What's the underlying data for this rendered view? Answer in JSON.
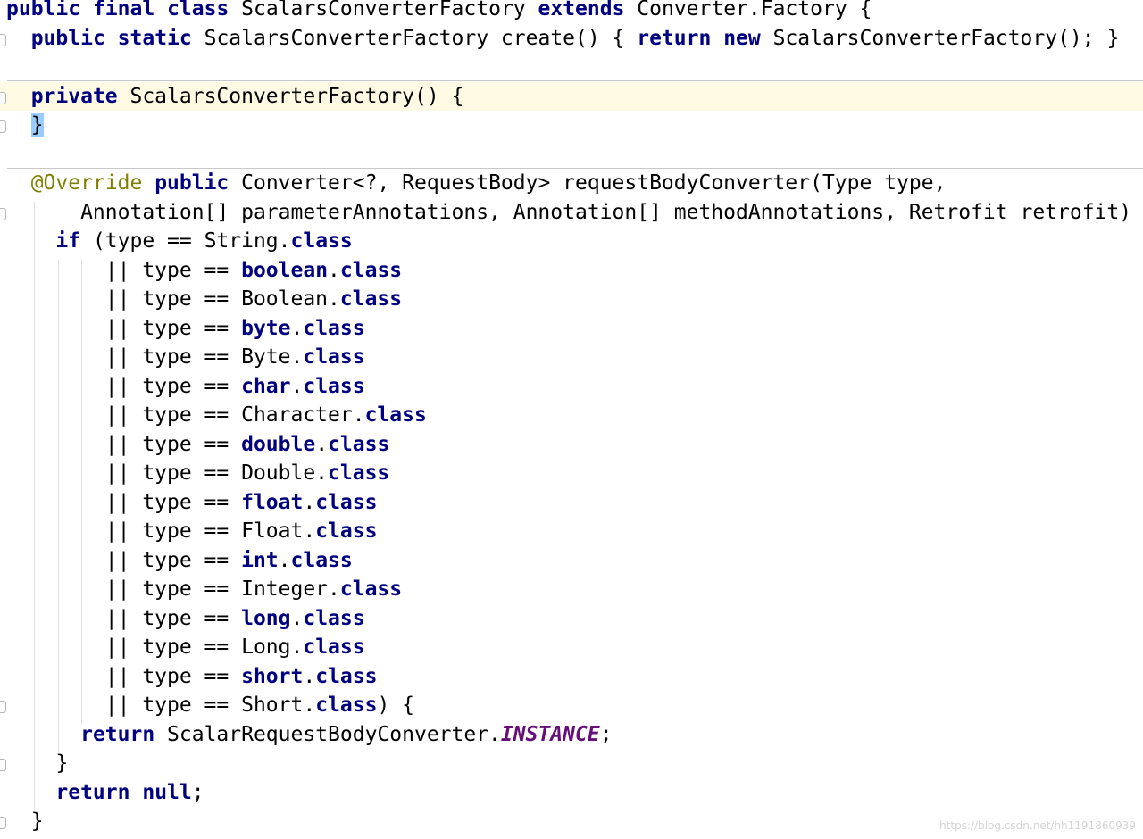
{
  "code_lines": [
    "public final class ScalarsConverterFactory extends Converter.Factory {",
    "  public static ScalarsConverterFactory create() { return new ScalarsConverterFactory(); }",
    "",
    "  private ScalarsConverterFactory() {",
    "  }",
    "",
    "  @Override public Converter<?, RequestBody> requestBodyConverter(Type type,",
    "      Annotation[] parameterAnnotations, Annotation[] methodAnnotations, Retrofit retrofit) {",
    "    if (type == String.class",
    "        || type == boolean.class",
    "        || type == Boolean.class",
    "        || type == byte.class",
    "        || type == Byte.class",
    "        || type == char.class",
    "        || type == Character.class",
    "        || type == double.class",
    "        || type == Double.class",
    "        || type == float.class",
    "        || type == Float.class",
    "        || type == int.class",
    "        || type == Integer.class",
    "        || type == long.class",
    "        || type == Long.class",
    "        || type == short.class",
    "        || type == Short.class) {",
    "      return ScalarRequestBodyConverter.INSTANCE;",
    "    }",
    "    return null;",
    "  }"
  ],
  "keywords": [
    "public",
    "final",
    "class",
    "extends",
    "static",
    "return",
    "new",
    "private",
    "if",
    "boolean",
    "byte",
    "char",
    "double",
    "float",
    "int",
    "long",
    "short",
    "null"
  ],
  "annotations": [
    "@Override"
  ],
  "static_fields": [
    "INSTANCE"
  ],
  "highlights": {
    "current_line": 3,
    "braces_soft": [
      [
        1,
        47
      ],
      [
        1,
        88
      ]
    ],
    "braces_match": [
      [
        3,
        34
      ],
      [
        4,
        2
      ]
    ]
  },
  "colors": {
    "keyword": "#000080",
    "annotation": "#808000",
    "static_field": "#660e7a",
    "current_line_bg": "#fffae3",
    "brace_match_bg": "#99ccff",
    "brace_soft_bg": "#e8f2e6"
  },
  "watermark": "https://blog.csdn.net/hh1191860939"
}
